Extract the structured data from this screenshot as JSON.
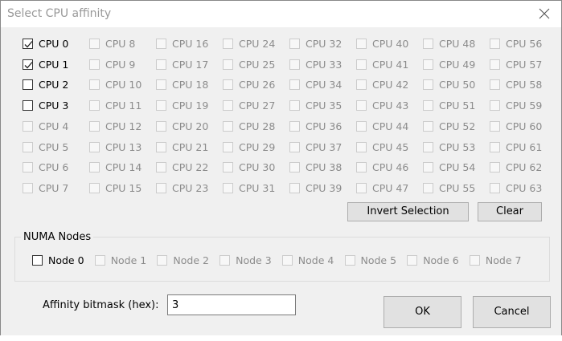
{
  "window": {
    "title": "Select CPU affinity",
    "close_icon": "close-icon"
  },
  "cpus": [
    {
      "label": "CPU 0",
      "checked": true,
      "enabled": true
    },
    {
      "label": "CPU 1",
      "checked": true,
      "enabled": true
    },
    {
      "label": "CPU 2",
      "checked": false,
      "enabled": true
    },
    {
      "label": "CPU 3",
      "checked": false,
      "enabled": true
    },
    {
      "label": "CPU 4",
      "checked": false,
      "enabled": false
    },
    {
      "label": "CPU 5",
      "checked": false,
      "enabled": false
    },
    {
      "label": "CPU 6",
      "checked": false,
      "enabled": false
    },
    {
      "label": "CPU 7",
      "checked": false,
      "enabled": false
    },
    {
      "label": "CPU 8",
      "checked": false,
      "enabled": false
    },
    {
      "label": "CPU 9",
      "checked": false,
      "enabled": false
    },
    {
      "label": "CPU 10",
      "checked": false,
      "enabled": false
    },
    {
      "label": "CPU 11",
      "checked": false,
      "enabled": false
    },
    {
      "label": "CPU 12",
      "checked": false,
      "enabled": false
    },
    {
      "label": "CPU 13",
      "checked": false,
      "enabled": false
    },
    {
      "label": "CPU 14",
      "checked": false,
      "enabled": false
    },
    {
      "label": "CPU 15",
      "checked": false,
      "enabled": false
    },
    {
      "label": "CPU 16",
      "checked": false,
      "enabled": false
    },
    {
      "label": "CPU 17",
      "checked": false,
      "enabled": false
    },
    {
      "label": "CPU 18",
      "checked": false,
      "enabled": false
    },
    {
      "label": "CPU 19",
      "checked": false,
      "enabled": false
    },
    {
      "label": "CPU 20",
      "checked": false,
      "enabled": false
    },
    {
      "label": "CPU 21",
      "checked": false,
      "enabled": false
    },
    {
      "label": "CPU 22",
      "checked": false,
      "enabled": false
    },
    {
      "label": "CPU 23",
      "checked": false,
      "enabled": false
    },
    {
      "label": "CPU 24",
      "checked": false,
      "enabled": false
    },
    {
      "label": "CPU 25",
      "checked": false,
      "enabled": false
    },
    {
      "label": "CPU 26",
      "checked": false,
      "enabled": false
    },
    {
      "label": "CPU 27",
      "checked": false,
      "enabled": false
    },
    {
      "label": "CPU 28",
      "checked": false,
      "enabled": false
    },
    {
      "label": "CPU 29",
      "checked": false,
      "enabled": false
    },
    {
      "label": "CPU 30",
      "checked": false,
      "enabled": false
    },
    {
      "label": "CPU 31",
      "checked": false,
      "enabled": false
    },
    {
      "label": "CPU 32",
      "checked": false,
      "enabled": false
    },
    {
      "label": "CPU 33",
      "checked": false,
      "enabled": false
    },
    {
      "label": "CPU 34",
      "checked": false,
      "enabled": false
    },
    {
      "label": "CPU 35",
      "checked": false,
      "enabled": false
    },
    {
      "label": "CPU 36",
      "checked": false,
      "enabled": false
    },
    {
      "label": "CPU 37",
      "checked": false,
      "enabled": false
    },
    {
      "label": "CPU 38",
      "checked": false,
      "enabled": false
    },
    {
      "label": "CPU 39",
      "checked": false,
      "enabled": false
    },
    {
      "label": "CPU 40",
      "checked": false,
      "enabled": false
    },
    {
      "label": "CPU 41",
      "checked": false,
      "enabled": false
    },
    {
      "label": "CPU 42",
      "checked": false,
      "enabled": false
    },
    {
      "label": "CPU 43",
      "checked": false,
      "enabled": false
    },
    {
      "label": "CPU 44",
      "checked": false,
      "enabled": false
    },
    {
      "label": "CPU 45",
      "checked": false,
      "enabled": false
    },
    {
      "label": "CPU 46",
      "checked": false,
      "enabled": false
    },
    {
      "label": "CPU 47",
      "checked": false,
      "enabled": false
    },
    {
      "label": "CPU 48",
      "checked": false,
      "enabled": false
    },
    {
      "label": "CPU 49",
      "checked": false,
      "enabled": false
    },
    {
      "label": "CPU 50",
      "checked": false,
      "enabled": false
    },
    {
      "label": "CPU 51",
      "checked": false,
      "enabled": false
    },
    {
      "label": "CPU 52",
      "checked": false,
      "enabled": false
    },
    {
      "label": "CPU 53",
      "checked": false,
      "enabled": false
    },
    {
      "label": "CPU 54",
      "checked": false,
      "enabled": false
    },
    {
      "label": "CPU 55",
      "checked": false,
      "enabled": false
    },
    {
      "label": "CPU 56",
      "checked": false,
      "enabled": false
    },
    {
      "label": "CPU 57",
      "checked": false,
      "enabled": false
    },
    {
      "label": "CPU 58",
      "checked": false,
      "enabled": false
    },
    {
      "label": "CPU 59",
      "checked": false,
      "enabled": false
    },
    {
      "label": "CPU 60",
      "checked": false,
      "enabled": false
    },
    {
      "label": "CPU 61",
      "checked": false,
      "enabled": false
    },
    {
      "label": "CPU 62",
      "checked": false,
      "enabled": false
    },
    {
      "label": "CPU 63",
      "checked": false,
      "enabled": false
    }
  ],
  "buttons": {
    "invert_selection": "Invert Selection",
    "clear": "Clear",
    "ok": "OK",
    "cancel": "Cancel"
  },
  "numa": {
    "group_label": "NUMA Nodes",
    "nodes": [
      {
        "label": "Node 0",
        "checked": false,
        "enabled": true
      },
      {
        "label": "Node 1",
        "checked": false,
        "enabled": false
      },
      {
        "label": "Node 2",
        "checked": false,
        "enabled": false
      },
      {
        "label": "Node 3",
        "checked": false,
        "enabled": false
      },
      {
        "label": "Node 4",
        "checked": false,
        "enabled": false
      },
      {
        "label": "Node 5",
        "checked": false,
        "enabled": false
      },
      {
        "label": "Node 6",
        "checked": false,
        "enabled": false
      },
      {
        "label": "Node 7",
        "checked": false,
        "enabled": false
      }
    ]
  },
  "bitmask": {
    "label": "Affinity bitmask (hex):",
    "value": "3"
  }
}
